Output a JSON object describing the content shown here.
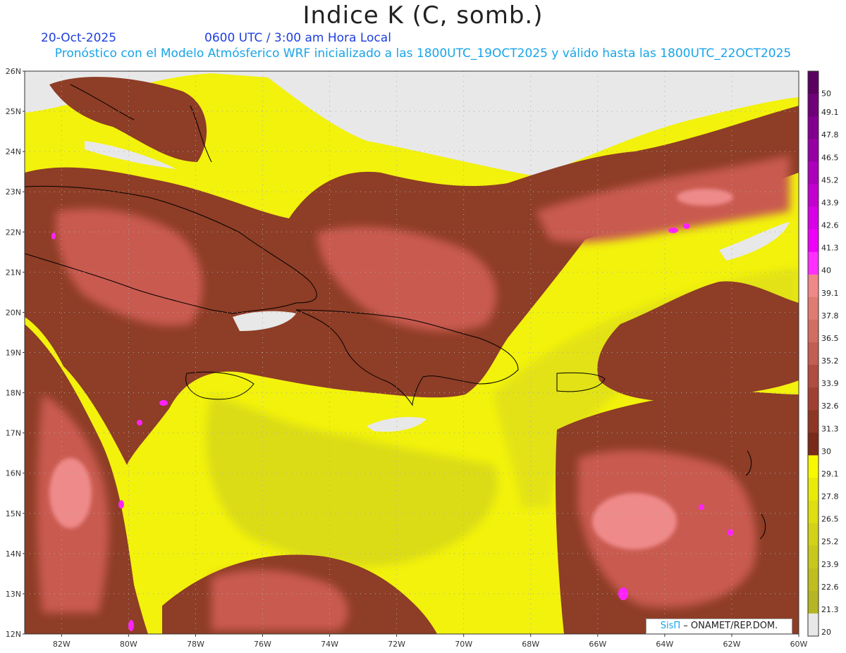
{
  "header": {
    "title": "Indice K (C, somb.)",
    "date": "20-Oct-2025",
    "time": "0600 UTC / 3:00 am Hora Local",
    "subtitle": "Pronóstico con el Modelo Atmósferico WRF inicializado a las 1800UTC_19OCT2025 y válido hasta las  1800UTC_22OCT2025"
  },
  "map": {
    "lat_range": [
      12,
      26
    ],
    "lon_range": [
      -83.1,
      -60
    ],
    "lat_labels": [
      "12N",
      "13N",
      "14N",
      "15N",
      "16N",
      "17N",
      "18N",
      "19N",
      "20N",
      "21N",
      "22N",
      "23N",
      "24N",
      "25N",
      "26N"
    ],
    "lon_labels": [
      "82W",
      "80W",
      "78W",
      "76W",
      "74W",
      "72W",
      "70W",
      "68W",
      "66W",
      "64W",
      "62W",
      "60W"
    ],
    "lon_ticks": [
      -82,
      -80,
      -78,
      -76,
      -74,
      -72,
      -70,
      -68,
      -66,
      -64,
      -62,
      -60
    ],
    "colors": {
      "land": "#e8e8e8",
      "below_20": "#e8e8e8",
      "yellow_low": "#d6d21a",
      "yellow_high": "#f5f50a",
      "brown": "#8e3d26",
      "red": "#c95a50",
      "pink": "#ef8a8a",
      "magenta": "#ff22ff"
    }
  },
  "colorbar": {
    "labels": [
      "50",
      "49.1",
      "47.8",
      "46.5",
      "45.2",
      "43.9",
      "42.6",
      "41.3",
      "40",
      "39.1",
      "37.8",
      "36.5",
      "35.2",
      "33.9",
      "32.6",
      "31.3",
      "30",
      "29.1",
      "27.8",
      "26.5",
      "25.2",
      "23.9",
      "22.6",
      "21.3",
      "20"
    ],
    "colors": [
      "#5a0060",
      "#6e0078",
      "#82008e",
      "#9600a4",
      "#ac00ba",
      "#c200d0",
      "#d800e6",
      "#ee00f8",
      "#ff30ff",
      "#f08888",
      "#e07b72",
      "#d36d62",
      "#c35e52",
      "#b04c40",
      "#a14032",
      "#8e3624",
      "#7a2a18",
      "#f8f800",
      "#eaea08",
      "#dede10",
      "#d2d218",
      "#c8c81c",
      "#bebe20",
      "#b6b624",
      "#e8e8e8"
    ]
  },
  "credit": {
    "sis": "SisΠ",
    "org": "– ONAMET/REP.DOM."
  }
}
